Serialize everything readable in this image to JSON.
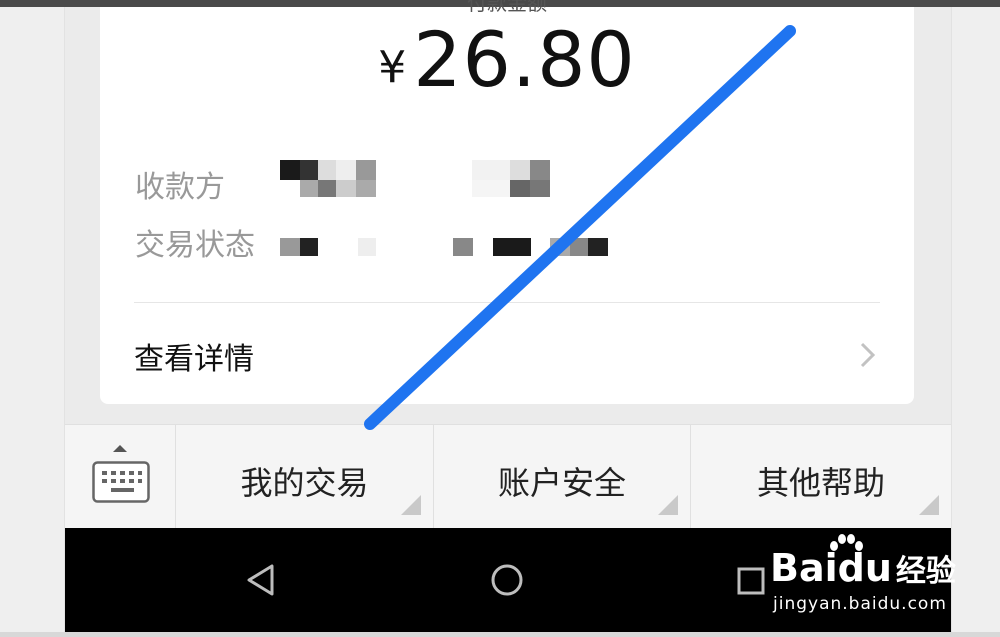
{
  "card": {
    "amount_header": "付款金额",
    "currency": "¥",
    "amount": "26.80",
    "payee_label": "收款方",
    "status_label": "交易状态",
    "details_label": "查看详情"
  },
  "menu": {
    "items": [
      {
        "label": "我的交易"
      },
      {
        "label": "账户安全"
      },
      {
        "label": "其他帮助"
      }
    ]
  },
  "watermark": {
    "logo_a": "Bai",
    "logo_b": "du",
    "logo_c": "经验",
    "site": "jingyan.baidu.com"
  },
  "colors": {
    "annotation_line": "#1f74f0",
    "nav_bar": "#000000",
    "menu_bg": "#f5f5f5",
    "card_bg": "#ffffff"
  },
  "icons": [
    "keyboard-icon",
    "chevron-right-icon",
    "nav-back-icon",
    "nav-home-icon",
    "nav-recent-icon",
    "baidu-paw-icon"
  ]
}
